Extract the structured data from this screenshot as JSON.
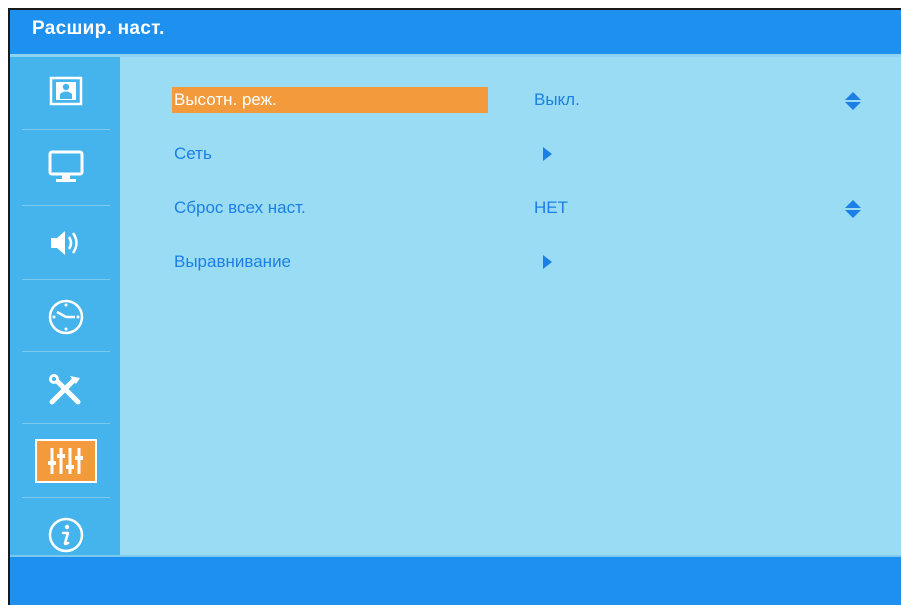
{
  "title": "Расшир. наст.",
  "sidebar": {
    "items": [
      {
        "icon": "picture-icon",
        "active": false
      },
      {
        "icon": "display-icon",
        "active": false
      },
      {
        "icon": "speaker-icon",
        "active": false
      },
      {
        "icon": "clock-icon",
        "active": false
      },
      {
        "icon": "tools-icon",
        "active": false
      },
      {
        "icon": "advanced-settings-icon",
        "active": true
      },
      {
        "icon": "info-icon",
        "active": false
      }
    ]
  },
  "menu": {
    "rows": [
      {
        "label": "Высотн. реж.",
        "value": "Выкл.",
        "control": "updown",
        "selected": true
      },
      {
        "label": "Сеть",
        "value": "",
        "control": "submenu",
        "selected": false
      },
      {
        "label": "Сброс всех наст.",
        "value": "НЕТ",
        "control": "updown",
        "selected": false
      },
      {
        "label": "Выравнивание",
        "value": "",
        "control": "submenu",
        "selected": false
      }
    ]
  },
  "colors": {
    "title_bar": "#1e90ef",
    "panel": "#9adcf3",
    "sidebar": "#45b4ec",
    "highlight": "#f29a3c",
    "text": "#1b7fe6"
  }
}
